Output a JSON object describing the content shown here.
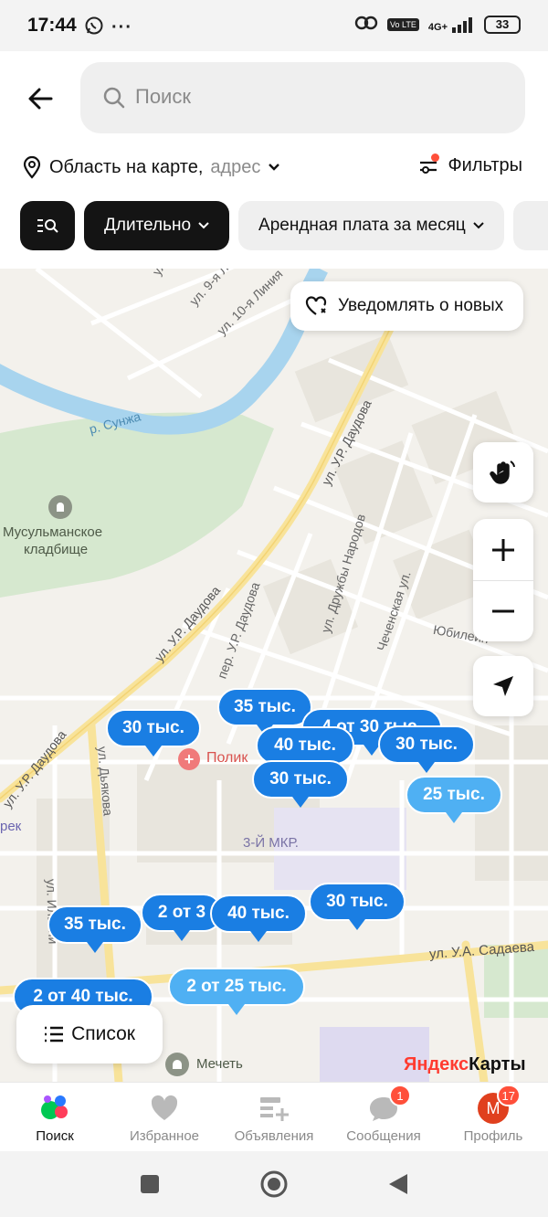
{
  "status_bar": {
    "time": "17:44",
    "network": "4G+",
    "volte": "Vo LTE",
    "battery": "33",
    "icons": [
      "whatsapp-icon",
      "more-dots-icon",
      "link-icon",
      "signal-icon"
    ]
  },
  "header": {
    "search_placeholder": "Поиск",
    "area_label": "Область на карте,",
    "area_sub": "адрес",
    "filters_label": "Фильтры"
  },
  "chips": [
    {
      "label": "",
      "icon": "filter-search-icon",
      "style": "dark"
    },
    {
      "label": "Длительно",
      "style": "dark",
      "caret": true
    },
    {
      "label": "Арендная плата за месяц",
      "style": "light",
      "caret": true
    },
    {
      "label": "",
      "style": "light"
    }
  ],
  "map": {
    "notify_label": "Уведомлять о новых",
    "labels": {
      "river": "р. Сунжа",
      "cemetery_1": "Мусульманское",
      "cemetery_2": "кладбище",
      "street_daudova_1": "ул. У.Р. Даудова",
      "street_daudova_2": "ул. У.Р. Даудова",
      "street_daudova_3": "ул. У.Р. Даудова",
      "lane_daudova": "пер. У.Р. Даудова",
      "street_druzhby": "ул. Дружбы Народов",
      "street_chechen": "Чеченская ул.",
      "street_yubil": "Юбилейн",
      "street_dyakova": "ул. Дьякова",
      "street_9": "ул. 9-я Л",
      "street_10": "ул. 10-я Линия",
      "street_ul": "ул.",
      "street_sadaeva": "ул. У.А. Садаева",
      "street_ilyani": "ул. Ильяни",
      "micro": "3-Й МКР.",
      "clinic": "Полик",
      "mosque": "Мечеть",
      "terek": "рек"
    },
    "pins": [
      {
        "label": "30 тыс.",
        "style": "dark"
      },
      {
        "label": "35 тыс.",
        "style": "dark"
      },
      {
        "label": "4 от 30 тыс.",
        "style": "dark"
      },
      {
        "label": "40 тыс.",
        "style": "dark"
      },
      {
        "label": "30 тыс.",
        "style": "dark"
      },
      {
        "label": "30 тыс.",
        "style": "dark"
      },
      {
        "label": "25 тыс.",
        "style": "light"
      },
      {
        "label": "35 тыс.",
        "style": "dark"
      },
      {
        "label": "2 от 3",
        "style": "dark"
      },
      {
        "label": "40 тыс.",
        "style": "dark"
      },
      {
        "label": "30 тыс.",
        "style": "dark"
      },
      {
        "label": "2 от 40 тыс.",
        "style": "dark"
      },
      {
        "label": "2 от 25 тыс.",
        "style": "light"
      }
    ],
    "list_label": "Список",
    "logo_part1": "Яндекс",
    "logo_part2": "Карты"
  },
  "bottom_nav": [
    {
      "label": "Поиск",
      "icon": "search-tab-icon",
      "active": true
    },
    {
      "label": "Избранное",
      "icon": "heart-icon"
    },
    {
      "label": "Объявления",
      "icon": "ads-icon"
    },
    {
      "label": "Сообщения",
      "icon": "chat-icon",
      "badge": "1"
    },
    {
      "label": "Профиль",
      "icon": "avatar",
      "badge": "17",
      "avatar_letter": "M"
    }
  ],
  "colors": {
    "pin_dark": "#1a7ee3",
    "pin_light": "#4fb0f3",
    "badge": "#ff4f3a",
    "river": "#a8d4ee",
    "park": "#d6e8cf",
    "main_road": "#f8e39a"
  }
}
